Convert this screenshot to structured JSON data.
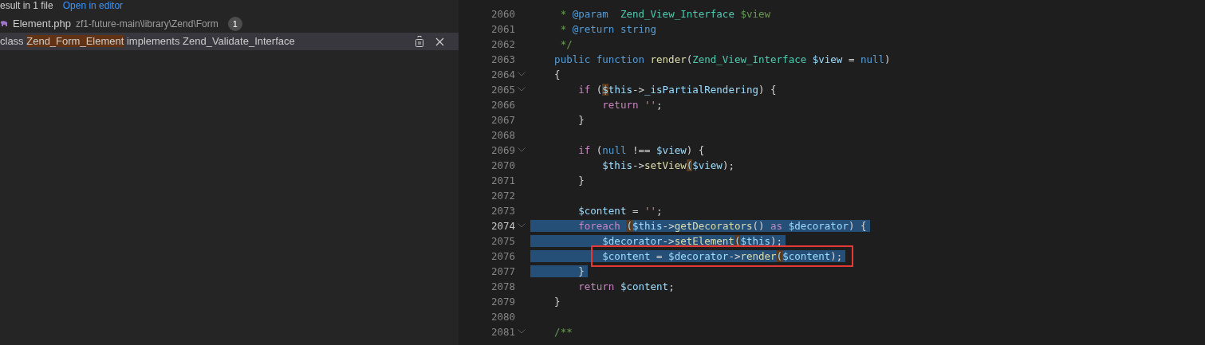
{
  "search_results": {
    "summary": "esult in 1 file",
    "open_link": "Open in editor",
    "file": {
      "name": "Element.php",
      "path": "zf1-future-main\\library\\Zend\\Form",
      "count": "1",
      "expanded": true
    },
    "matches": [
      {
        "before": "class ",
        "match": "Zend_Form_Element",
        "after": " implements Zend_Validate_Interface",
        "selected": true
      }
    ]
  },
  "editor": {
    "lines": [
      {
        "number": "2060",
        "foldable": false,
        "selected": false,
        "current": false,
        "boxed": false,
        "tokens": [
          {
            "kind": "comment",
            "text": "     * "
          },
          {
            "kind": "doc",
            "text": "@param  "
          },
          {
            "kind": "type",
            "text": "Zend_View_Interface "
          },
          {
            "kind": "comment",
            "text": "$view"
          }
        ]
      },
      {
        "number": "2061",
        "foldable": false,
        "selected": false,
        "current": false,
        "boxed": false,
        "tokens": [
          {
            "kind": "comment",
            "text": "     * "
          },
          {
            "kind": "doc",
            "text": "@return "
          },
          {
            "kind": "doc",
            "text": "string"
          }
        ]
      },
      {
        "number": "2062",
        "foldable": false,
        "selected": false,
        "current": false,
        "boxed": false,
        "tokens": [
          {
            "kind": "comment",
            "text": "     */"
          }
        ]
      },
      {
        "number": "2063",
        "foldable": false,
        "selected": false,
        "current": false,
        "boxed": false,
        "tokens": [
          {
            "kind": "keyword",
            "text": "    public "
          },
          {
            "kind": "keyword",
            "text": "function "
          },
          {
            "kind": "function",
            "text": "render"
          },
          {
            "kind": "plain",
            "text": "("
          },
          {
            "kind": "type",
            "text": "Zend_View_Interface "
          },
          {
            "kind": "variable",
            "text": "$view"
          },
          {
            "kind": "plain",
            "text": " = "
          },
          {
            "kind": "keyword",
            "text": "null"
          },
          {
            "kind": "plain",
            "text": ")"
          }
        ]
      },
      {
        "number": "2064",
        "foldable": true,
        "selected": false,
        "current": false,
        "boxed": false,
        "tokens": [
          {
            "kind": "plain",
            "text": "    {"
          }
        ]
      },
      {
        "number": "2065",
        "foldable": true,
        "selected": false,
        "current": false,
        "boxed": false,
        "tokens": [
          {
            "kind": "control",
            "text": "        if "
          },
          {
            "kind": "plain",
            "text": "("
          },
          {
            "kind": "match",
            "text": "$"
          },
          {
            "kind": "variable",
            "text": "this"
          },
          {
            "kind": "plain",
            "text": "->"
          },
          {
            "kind": "variable",
            "text": "_isPartialRendering"
          },
          {
            "kind": "plain",
            "text": ") {"
          }
        ]
      },
      {
        "number": "2066",
        "foldable": false,
        "selected": false,
        "current": false,
        "boxed": false,
        "tokens": [
          {
            "kind": "control",
            "text": "            return "
          },
          {
            "kind": "string",
            "text": "''"
          },
          {
            "kind": "plain",
            "text": ";"
          }
        ]
      },
      {
        "number": "2067",
        "foldable": false,
        "selected": false,
        "current": false,
        "boxed": false,
        "tokens": [
          {
            "kind": "plain",
            "text": "        }"
          }
        ]
      },
      {
        "number": "2068",
        "foldable": false,
        "selected": false,
        "current": false,
        "boxed": false
      },
      {
        "number": "2069",
        "foldable": true,
        "selected": false,
        "current": false,
        "boxed": false,
        "tokens": [
          {
            "kind": "control",
            "text": "        if"
          },
          {
            "kind": "plain",
            "text": " ("
          },
          {
            "kind": "keyword",
            "text": "null"
          },
          {
            "kind": "plain",
            "text": " !== "
          },
          {
            "kind": "variable",
            "text": "$view"
          },
          {
            "kind": "plain",
            "text": ") {"
          }
        ]
      },
      {
        "number": "2070",
        "foldable": false,
        "selected": false,
        "current": false,
        "boxed": false,
        "tokens": [
          {
            "kind": "variable",
            "text": "            $this"
          },
          {
            "kind": "plain",
            "text": "->"
          },
          {
            "kind": "function",
            "text": "setView"
          },
          {
            "kind": "match",
            "text": "("
          },
          {
            "kind": "variable",
            "text": "$view"
          },
          {
            "kind": "plain",
            "text": ");"
          }
        ]
      },
      {
        "number": "2071",
        "foldable": false,
        "selected": false,
        "current": false,
        "boxed": false,
        "tokens": [
          {
            "kind": "plain",
            "text": "        }"
          }
        ]
      },
      {
        "number": "2072",
        "foldable": false,
        "selected": false,
        "current": false,
        "boxed": false
      },
      {
        "number": "2073",
        "foldable": false,
        "selected": false,
        "current": false,
        "boxed": false,
        "tokens": [
          {
            "kind": "variable",
            "text": "        $content"
          },
          {
            "kind": "plain",
            "text": " = "
          },
          {
            "kind": "string",
            "text": "''"
          },
          {
            "kind": "plain",
            "text": ";"
          }
        ]
      },
      {
        "number": "2074",
        "foldable": true,
        "selected": true,
        "current": true,
        "boxed": false,
        "tokens": [
          {
            "kind": "control",
            "text": "        foreach "
          },
          {
            "kind": "match",
            "text": "("
          },
          {
            "kind": "variable",
            "text": "$this"
          },
          {
            "kind": "plain",
            "text": "->"
          },
          {
            "kind": "function",
            "text": "getDecorators"
          },
          {
            "kind": "plain",
            "text": "() "
          },
          {
            "kind": "control",
            "text": "as "
          },
          {
            "kind": "variable",
            "text": "$decorator"
          },
          {
            "kind": "plain",
            "text": ") {"
          }
        ]
      },
      {
        "number": "2075",
        "foldable": false,
        "selected": true,
        "current": false,
        "boxed": false,
        "tokens": [
          {
            "kind": "variable",
            "text": "            $decorator"
          },
          {
            "kind": "plain",
            "text": "->"
          },
          {
            "kind": "function",
            "text": "setElement"
          },
          {
            "kind": "match",
            "text": "("
          },
          {
            "kind": "variable",
            "text": "$this"
          },
          {
            "kind": "plain",
            "text": ");"
          }
        ]
      },
      {
        "number": "2076",
        "foldable": false,
        "selected": true,
        "current": false,
        "boxed": true,
        "tokens": [
          {
            "kind": "variable",
            "text": "            $content"
          },
          {
            "kind": "plain",
            "text": " = "
          },
          {
            "kind": "variable",
            "text": "$decorator"
          },
          {
            "kind": "plain",
            "text": "->"
          },
          {
            "kind": "function",
            "text": "render"
          },
          {
            "kind": "match",
            "text": "("
          },
          {
            "kind": "variable",
            "text": "$content"
          },
          {
            "kind": "plain",
            "text": ");"
          }
        ]
      },
      {
        "number": "2077",
        "foldable": false,
        "selected": true,
        "current": false,
        "boxed": false,
        "tokens": [
          {
            "kind": "plain",
            "text": "        }"
          }
        ]
      },
      {
        "number": "2078",
        "foldable": false,
        "selected": false,
        "current": false,
        "boxed": false,
        "tokens": [
          {
            "kind": "control",
            "text": "        return "
          },
          {
            "kind": "variable",
            "text": "$content"
          },
          {
            "kind": "plain",
            "text": ";"
          }
        ]
      },
      {
        "number": "2079",
        "foldable": false,
        "selected": false,
        "current": false,
        "boxed": false,
        "tokens": [
          {
            "kind": "plain",
            "text": "    }"
          }
        ]
      },
      {
        "number": "2080",
        "foldable": false,
        "selected": false,
        "current": false,
        "boxed": false
      },
      {
        "number": "2081",
        "foldable": true,
        "selected": false,
        "current": false,
        "boxed": false,
        "tokens": [
          {
            "kind": "comment",
            "text": "    /**"
          }
        ]
      }
    ]
  }
}
